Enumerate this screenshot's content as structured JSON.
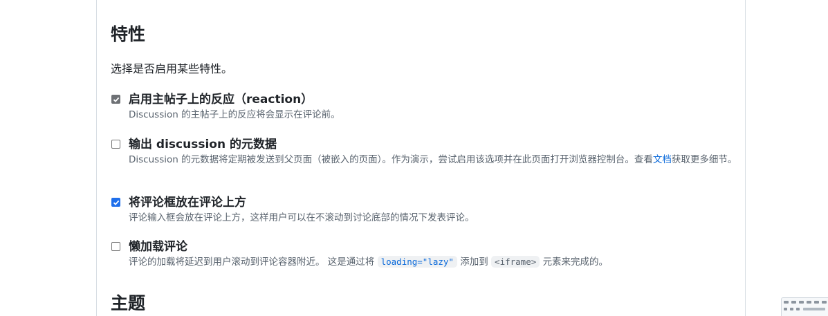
{
  "features_section": {
    "heading": "特性",
    "intro": "选择是否启用某些特性。",
    "items": [
      {
        "title": "启用主帖子上的反应（reaction）",
        "checked": true,
        "description": "Discussion 的主帖子上的反应将会显示在评论前。"
      },
      {
        "title": "输出 discussion 的元数据",
        "checked": false,
        "description": "Discussion 的元数据将定期被发送到父页面（被嵌入的页面）。作为演示，尝试启用该选项并在此页面打开浏览器控制台。查看",
        "link_text": "文档",
        "description_after": "获取更多细节。"
      },
      {
        "title": "将评论框放在评论上方",
        "checked": true,
        "description": "评论输入框会放在评论上方，这样用户可以在不滚动到讨论底部的情况下发表评论。"
      },
      {
        "title": "懒加载评论",
        "checked": false,
        "description_before": "评论的加载将延迟到用户滚动到评论容器附近。 这是通过将",
        "code1": "loading=\"lazy\"",
        "description_mid": "添加到",
        "code2": "<iframe>",
        "description_after": "元素来完成的。"
      }
    ]
  },
  "theme_section": {
    "heading": "主题"
  },
  "colors": {
    "link": "#0969da",
    "checkbox_grey": "#6e7175",
    "checkbox_blue": "#1f6feb",
    "text": "#1f2328",
    "muted": "#59636e"
  }
}
